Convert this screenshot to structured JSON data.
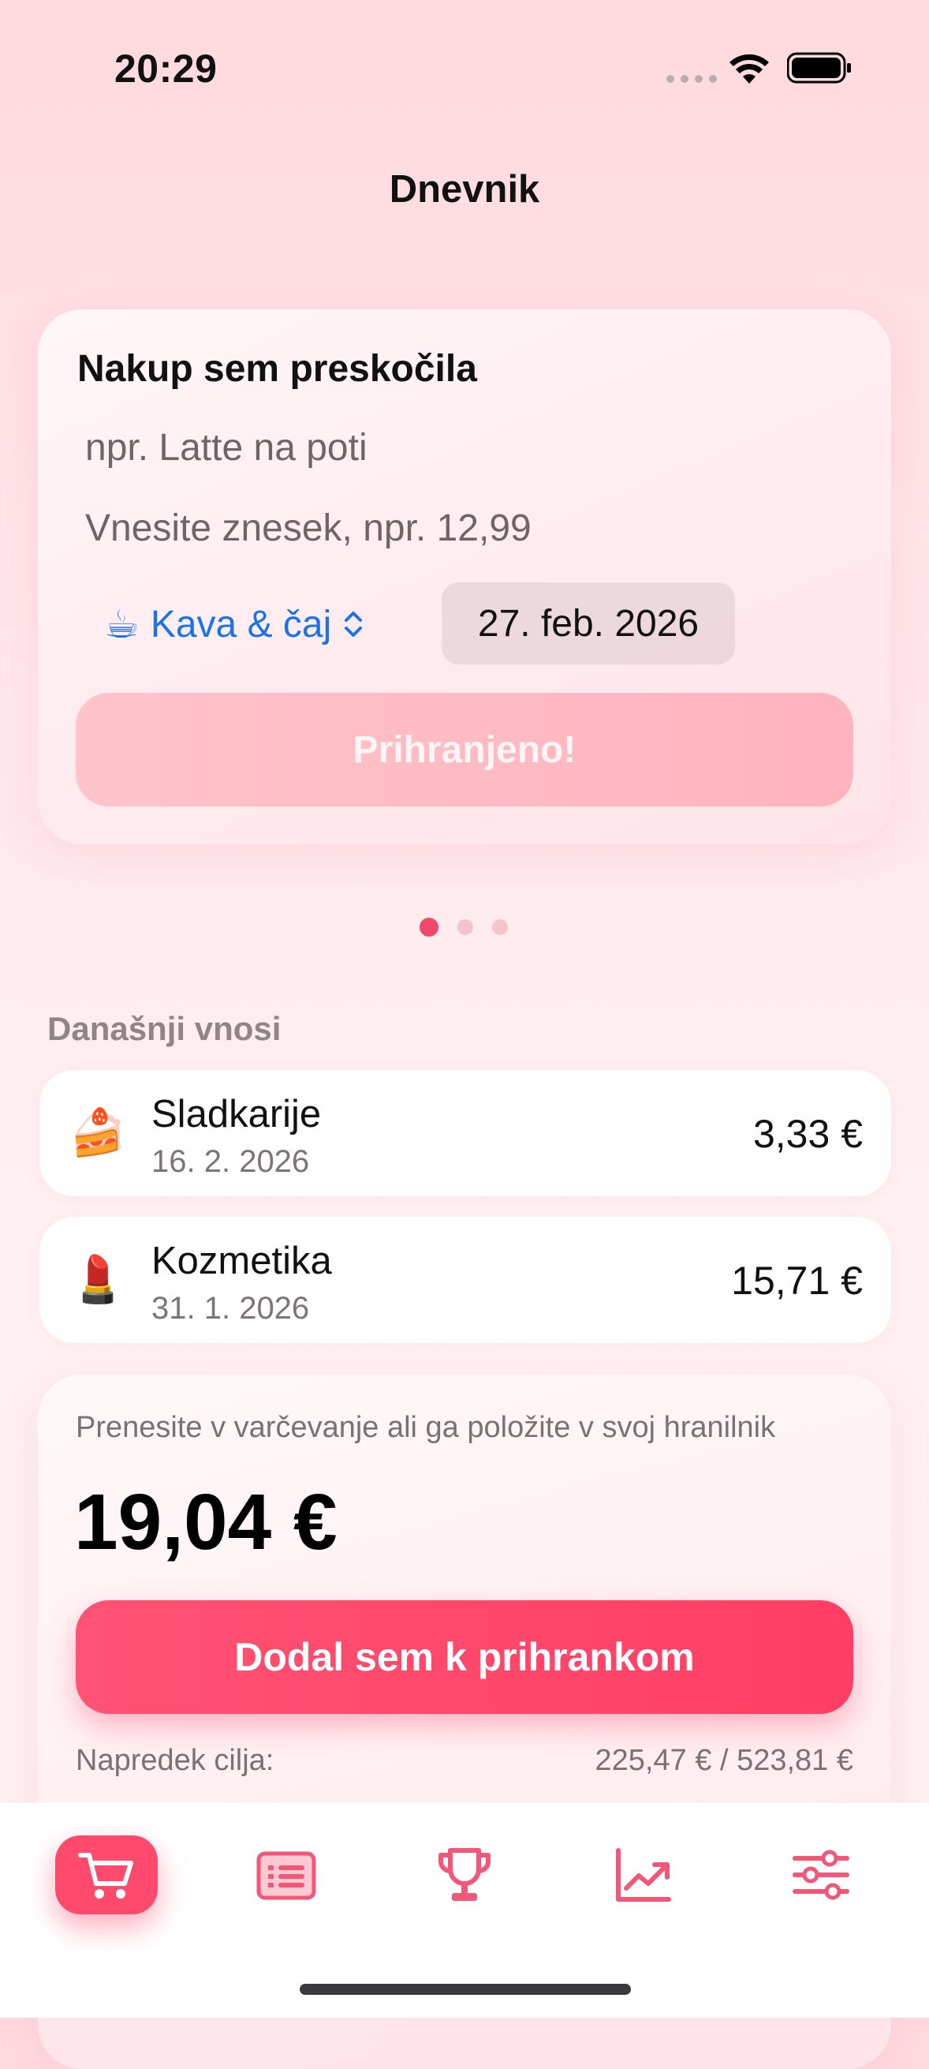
{
  "status_bar": {
    "time": "20:29"
  },
  "nav": {
    "title": "Dnevnik"
  },
  "quick_entry": {
    "title": "Nakup sem preskočila",
    "name_placeholder": "npr. Latte na poti",
    "amount_placeholder": "Vnesite znesek, npr. 12,99",
    "category_emoji": "☕",
    "category_label": "Kava & čaj",
    "date": "27. feb. 2026",
    "save_label": "Prihranjeno!"
  },
  "pager": {
    "pages": 3,
    "current": 1
  },
  "entries_section": {
    "heading": "Današnji vnosi",
    "items": [
      {
        "emoji": "🍰",
        "name": "Sladkarije",
        "date": "16. 2. 2026",
        "amount": "3,33 €"
      },
      {
        "emoji": "💄",
        "name": "Kozmetika",
        "date": "31. 1. 2026",
        "amount": "15,71 €"
      }
    ]
  },
  "savings": {
    "hint": "Prenesite v varčevanje ali ga položite v svoj hranilnik",
    "total": "19,04 €",
    "button_label": "Dodal sem k prihrankom",
    "goal_label": "Napredek cilja:",
    "goal_value": "225,47 € / 523,81 €"
  },
  "tabbar": {
    "items": [
      {
        "icon": "cart-icon",
        "active": true
      },
      {
        "icon": "list-icon",
        "active": false
      },
      {
        "icon": "trophy-icon",
        "active": false
      },
      {
        "icon": "chart-icon",
        "active": false
      },
      {
        "icon": "sliders-icon",
        "active": false
      }
    ]
  },
  "colors": {
    "accent": "#ff4a6d",
    "link": "#1b73e8",
    "background": "#ffe6ea"
  }
}
